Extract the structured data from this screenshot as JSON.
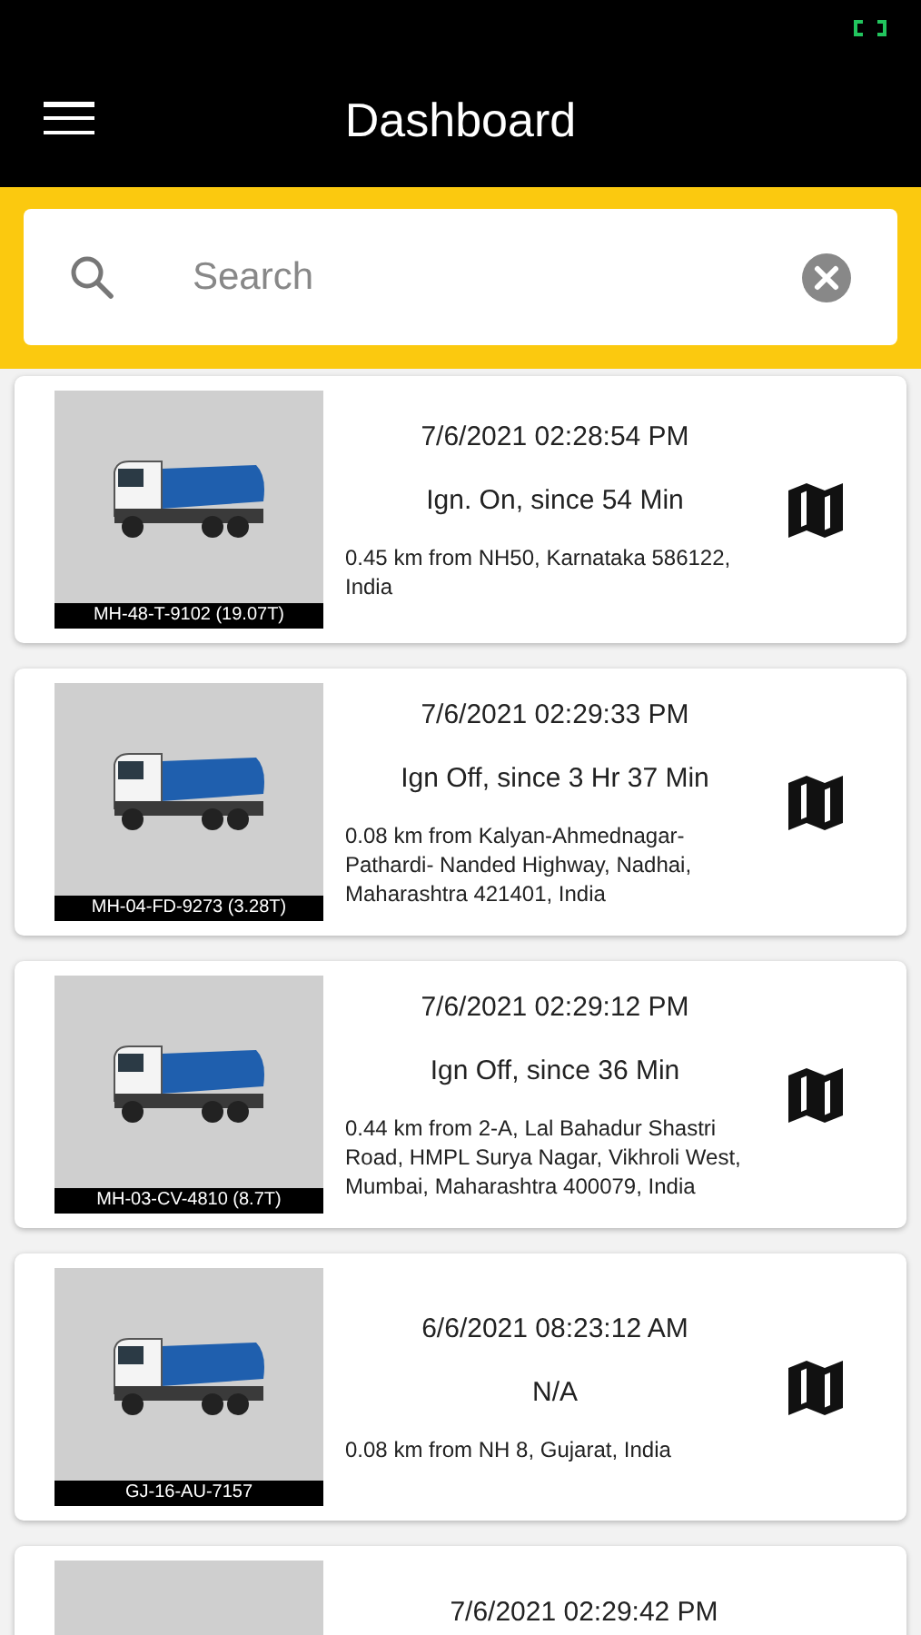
{
  "header": {
    "title": "Dashboard"
  },
  "search": {
    "placeholder": "Search"
  },
  "vehicles": [
    {
      "plate": "MH-48-T-9102 (19.07T)",
      "time": "7/6/2021 02:28:54 PM",
      "status": "Ign. On, since 54 Min",
      "location": "0.45 km from NH50, Karnataka 586122, India"
    },
    {
      "plate": "MH-04-FD-9273 (3.28T)",
      "time": "7/6/2021 02:29:33 PM",
      "status": "Ign Off, since 3 Hr 37 Min",
      "location": "0.08 km from Kalyan-Ahmednagar- Pathardi- Nanded Highway, Nadhai, Maharashtra 421401, India"
    },
    {
      "plate": "MH-03-CV-4810 (8.7T)",
      "time": "7/6/2021 02:29:12 PM",
      "status": "Ign Off, since 36 Min",
      "location": "0.44 km from 2-A, Lal Bahadur Shastri Road, HMPL Surya Nagar, Vikhroli West, Mumbai, Maharashtra 400079, India"
    },
    {
      "plate": "GJ-16-AU-7157",
      "time": "6/6/2021 08:23:12 AM",
      "status": "N/A",
      "location": "0.08 km from NH 8, Gujarat, India"
    },
    {
      "time": "7/6/2021 02:29:42 PM"
    }
  ]
}
